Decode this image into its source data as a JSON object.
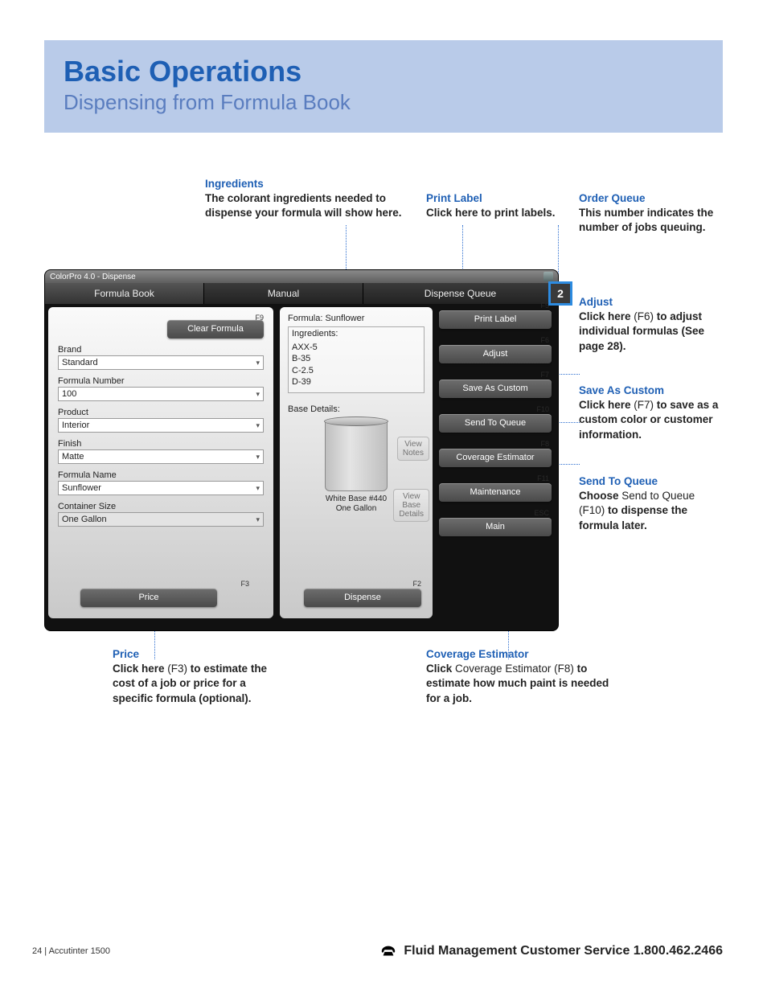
{
  "header": {
    "title": "Basic Operations",
    "subtitle": "Dispensing from Formula Book"
  },
  "callouts": {
    "ingredients": {
      "head": "Ingredients",
      "body": "The colorant ingredients needed to dispense your formula will show here."
    },
    "print_label": {
      "head": "Print Label",
      "body": "Click here to print labels."
    },
    "order_queue": {
      "head": "Order Queue",
      "body": "This number indicates the number of jobs queuing."
    },
    "adjust": {
      "head": "Adjust",
      "body_a": "Click here ",
      "key": "(F6)",
      "body_b": " to adjust individual formulas (See page 28)."
    },
    "save_as_custom": {
      "head": "Save As Custom",
      "body_a": "Click here ",
      "key": "(F7)",
      "body_b": " to save as a custom color or customer information."
    },
    "send_to_queue": {
      "head": "Send To Queue",
      "body_a": "Choose ",
      "mid": "Send to Queue ",
      "key": "(F10)",
      "body_b": " to dispense the formula later."
    },
    "price": {
      "head": "Price",
      "body_a": "Click here ",
      "key": "(F3)",
      "body_b": " to estimate the cost of a job or price for a specific formula (optional)."
    },
    "coverage": {
      "head": "Coverage Estimator",
      "body_a": "Click ",
      "mid": "Coverage Estimator (F8) ",
      "body_b": "to estimate how much paint is needed for a job."
    }
  },
  "window": {
    "title": "ColorPro 4.0 - Dispense",
    "tabs": {
      "t1": "Formula Book",
      "t2": "Manual",
      "t3": "Dispense Queue"
    },
    "queue_count": "2",
    "left": {
      "clear_btn": "Clear Formula",
      "clear_fk": "F9",
      "brand_lbl": "Brand",
      "brand_val": "Standard",
      "fnum_lbl": "Formula Number",
      "fnum_val": "100",
      "product_lbl": "Product",
      "product_val": "Interior",
      "finish_lbl": "Finish",
      "finish_val": "Matte",
      "fname_lbl": "Formula Name",
      "fname_val": "Sunflower",
      "csize_lbl": "Container Size",
      "csize_val": "One Gallon",
      "price_btn": "Price",
      "price_fk": "F3"
    },
    "mid": {
      "formula_line": "Formula: Sunflower",
      "ing_lbl": "Ingredients:",
      "ing1": "AXX-5",
      "ing2": "B-35",
      "ing3": "C-2.5",
      "ing4": "D-39",
      "base_lbl": "Base Details:",
      "base_line1": "White Base #440",
      "base_line2": "One Gallon",
      "view_notes_1": "View",
      "view_notes_2": "Notes",
      "view_base_1": "View",
      "view_base_2": "Base",
      "view_base_3": "Details",
      "dispense_btn": "Dispense",
      "dispense_fk": "F2"
    },
    "right": {
      "b1": "Print Label",
      "f1": "F5",
      "b2": "Adjust",
      "f2": "F6",
      "b3": "Save As Custom",
      "f3": "F7",
      "b4": "Send To Queue",
      "f4": "F10",
      "b5": "Coverage Estimator",
      "f5": "F8",
      "b6": "Maintenance",
      "f6": "F11",
      "b7": "Main",
      "f7": "ESC"
    }
  },
  "footer": {
    "page_marker": "24   |   Accutinter 1500",
    "service_text": "Fluid Management Customer Service 1.800.462.2466"
  }
}
